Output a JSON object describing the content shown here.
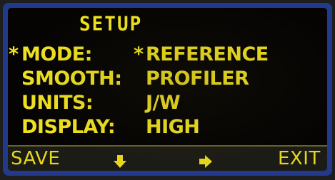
{
  "screen": {
    "title": "SETUP",
    "rows": [
      {
        "cursor": "*",
        "label": "MODE:",
        "value_cursor": "*",
        "value": "REFERENCE"
      },
      {
        "cursor": "",
        "label": "SMOOTH:",
        "value_cursor": "",
        "value": "PROFILER"
      },
      {
        "cursor": "",
        "label": "UNITS:",
        "value_cursor": "",
        "value": "J/W"
      },
      {
        "cursor": "",
        "label": "DISPLAY:",
        "value_cursor": "",
        "value": "HIGH"
      }
    ]
  },
  "softkeys": {
    "save": "SAVE",
    "down_icon": "arrow-down-icon",
    "right_icon": "arrow-right-icon",
    "exit": "EXIT"
  },
  "colors": {
    "text": "#f0e221",
    "screen_bg": "#050403",
    "frame": "#233a8c"
  }
}
